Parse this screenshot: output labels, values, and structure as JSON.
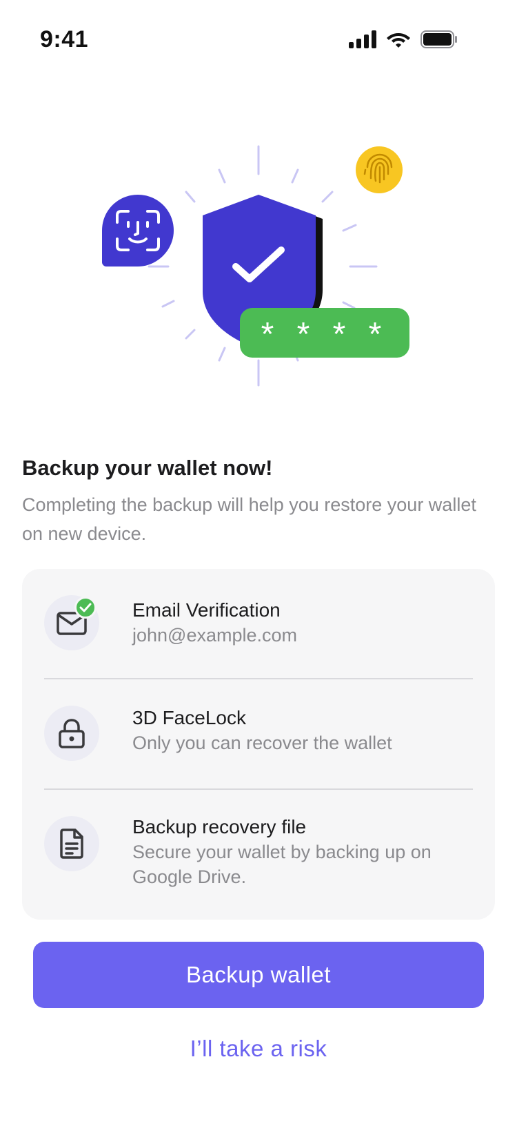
{
  "status_bar": {
    "time": "9:41",
    "icons": [
      "cellular-signal-icon",
      "wifi-icon",
      "battery-icon"
    ]
  },
  "illustration": {
    "password_mask": "* * * *",
    "icons": [
      "face-id-icon",
      "shield-check-icon",
      "fingerprint-icon"
    ],
    "colors": {
      "shield": "#4138cf",
      "password_pill": "#4cbb54",
      "fingerprint_badge": "#f8c622",
      "rays": "#c9c6f4"
    }
  },
  "header": {
    "title": "Backup your wallet now!",
    "subtitle": "Completing the backup will help you restore your wallet on new device."
  },
  "backup_steps": [
    {
      "title": "Email Verification",
      "subtitle": "john@example.com",
      "icon": "mail-icon",
      "completed": true
    },
    {
      "title": "3D FaceLock",
      "subtitle": "Only you can recover the wallet",
      "icon": "lock-icon",
      "completed": false
    },
    {
      "title": "Backup recovery file",
      "subtitle": "Secure your wallet by backing up on Google Drive.",
      "icon": "document-icon",
      "completed": false
    }
  ],
  "actions": {
    "primary_label": "Backup wallet",
    "secondary_label": "I’ll take a risk"
  },
  "colors": {
    "accent": "#6b63f0",
    "success": "#4cbb54",
    "card_bg": "#f6f6f7",
    "muted_text": "#8a8a8e"
  }
}
